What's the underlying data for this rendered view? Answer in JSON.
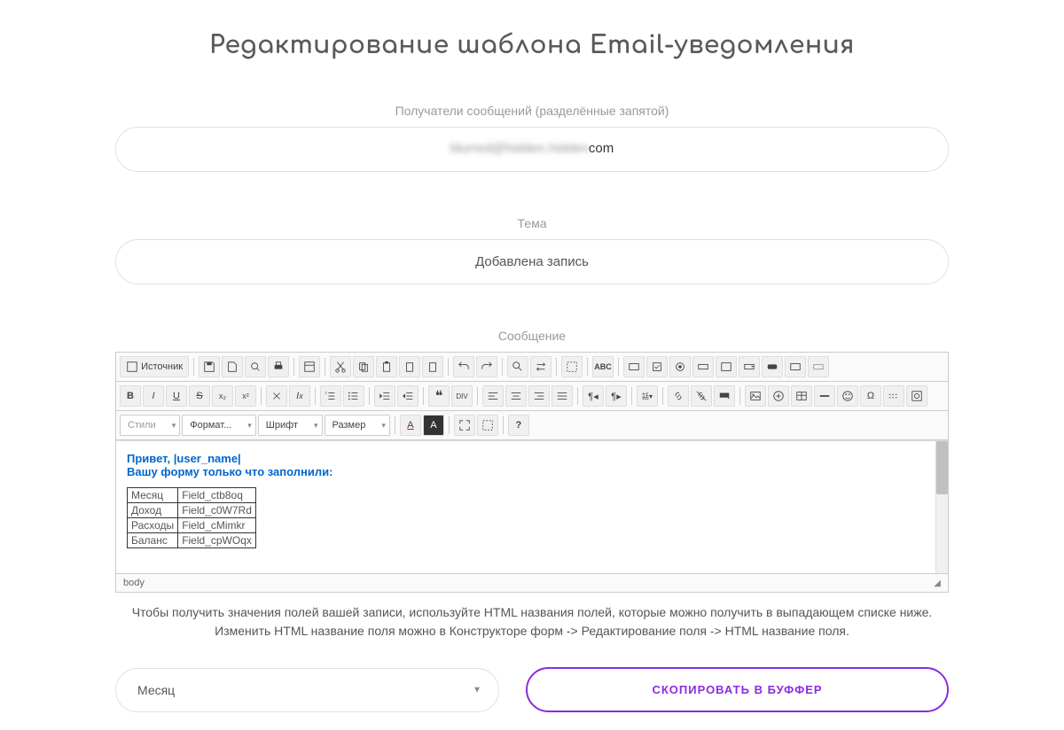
{
  "page": {
    "title": "Редактирование шаблона Email-уведомления"
  },
  "recipients": {
    "label": "Получатели сообщений (разделённые запятой)",
    "value_blurred": "blurred@hidden.hidden",
    "value_suffix": "com"
  },
  "subject": {
    "label": "Тема",
    "value": "Добавлена запись"
  },
  "message": {
    "label": "Сообщение"
  },
  "toolbar": {
    "source": "Источник",
    "styles": "Стили",
    "format": "Формат...",
    "font": "Шрифт",
    "size": "Размер",
    "text_color": "A",
    "bg_color": "A"
  },
  "editor": {
    "greeting": "Привет, |user_name|",
    "filled": "Вашу форму только что заполнили:",
    "status_path": "body",
    "table": [
      {
        "label": "Месяц",
        "field": "Field_ctb8oq"
      },
      {
        "label": "Доход",
        "field": "Field_c0W7Rd"
      },
      {
        "label": "Расходы",
        "field": "Field_cMimkr"
      },
      {
        "label": "Баланс",
        "field": "Field_cpWOqx"
      }
    ]
  },
  "help": {
    "line1": "Чтобы получить значения полей вашей записи, используйте HTML названия полей, которые можно получить в выпадающем списке ниже.",
    "line2": "Изменить HTML название поля можно в Конструкторе форм -> Редактирование поля -> HTML название поля."
  },
  "bottom": {
    "select_value": "Месяц",
    "copy_button": "СКОПИРОВАТЬ В БУФФЕР"
  }
}
